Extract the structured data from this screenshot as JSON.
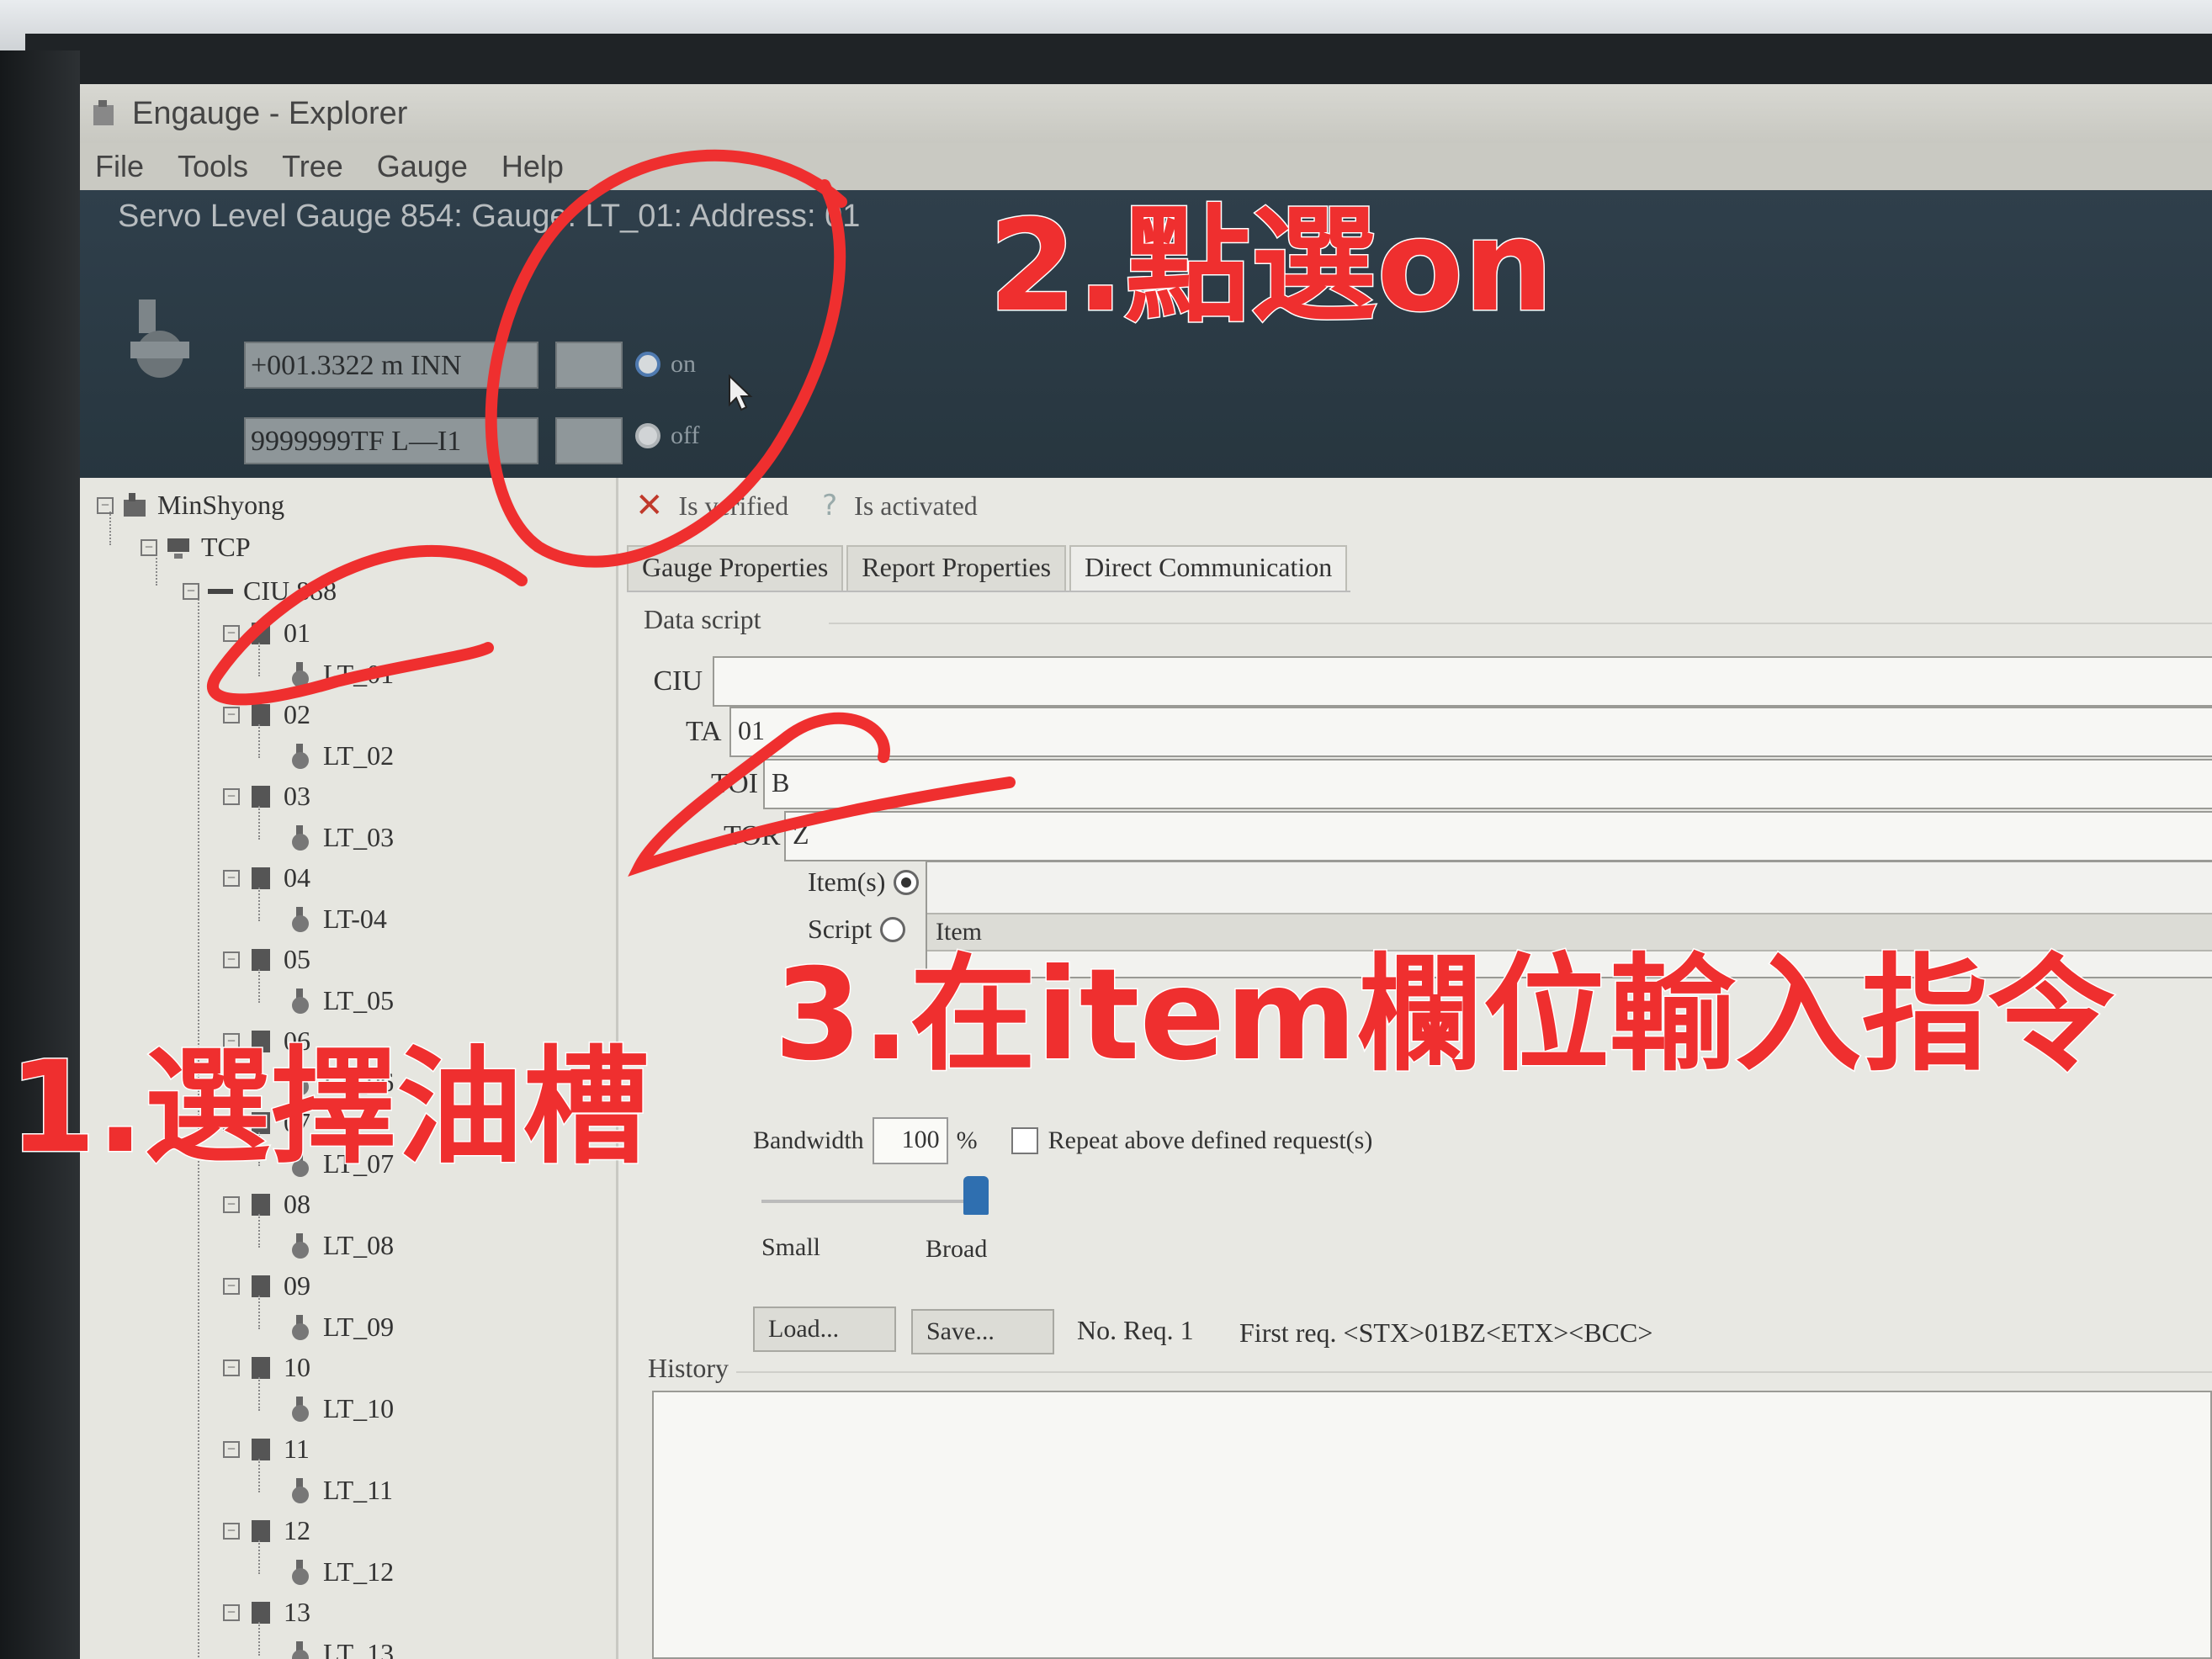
{
  "window": {
    "title": "Engauge - Explorer",
    "menu": [
      "File",
      "Tools",
      "Tree",
      "Gauge",
      "Help"
    ]
  },
  "header": {
    "gauge_title": "Servo Level Gauge 854: Gauge: LT_01: Address: 01",
    "readout1": "+001.3322  m INN",
    "readout2": "9999999TF L—I1",
    "on_label": "on",
    "off_label": "off",
    "selected": "on"
  },
  "tree": {
    "root": "MinShyong",
    "protocol": "TCP",
    "ciu": "CIU 888",
    "groups": [
      {
        "id": "01",
        "gauge": "LT_01"
      },
      {
        "id": "02",
        "gauge": "LT_02"
      },
      {
        "id": "03",
        "gauge": "LT_03"
      },
      {
        "id": "04",
        "gauge": "LT-04"
      },
      {
        "id": "05",
        "gauge": "LT_05"
      },
      {
        "id": "06",
        "gauge": "LT_06"
      },
      {
        "id": "07",
        "gauge": "LT_07"
      },
      {
        "id": "08",
        "gauge": "LT_08"
      },
      {
        "id": "09",
        "gauge": "LT_09"
      },
      {
        "id": "10",
        "gauge": "LT_10"
      },
      {
        "id": "11",
        "gauge": "LT_11"
      },
      {
        "id": "12",
        "gauge": "LT_12"
      },
      {
        "id": "13",
        "gauge": "LT_13"
      }
    ]
  },
  "status": {
    "verified": "Is verified",
    "activated": "Is activated"
  },
  "tabs": [
    "Gauge Properties",
    "Report Properties",
    "Direct Communication"
  ],
  "active_tab": "Direct Communication",
  "data_script": {
    "group_title": "Data script",
    "ciu_label": "CIU",
    "ciu_value": "",
    "ta_label": "TA",
    "ta_value": "01",
    "toi_label": "TOI",
    "toi_value": "B",
    "tod_label": "TOR",
    "tod_value": "Z",
    "items_label": "Item(s)",
    "script_label": "Script",
    "item_col": "Item"
  },
  "bandwidth": {
    "label": "Bandwidth",
    "value": "100",
    "unit": "%",
    "repeat_label": "Repeat above defined request(s)",
    "small": "Small",
    "broad": "Broad",
    "slider_level": 1.0
  },
  "actions": {
    "load": "Load...",
    "save": "Save...",
    "no_req": "No. Req.  1",
    "first_req": "First req.  <STX>01BZ<ETX><BCC>"
  },
  "history": {
    "title": "History"
  },
  "annotations": {
    "step1": "1.選擇油槽",
    "step2": "2.點選on",
    "step3": "3.在item欄位輸入指令"
  },
  "colors": {
    "annotation": "#ef2f2f",
    "header_bg": "#2f3f4b",
    "radio_on": "#4f7ab0"
  }
}
